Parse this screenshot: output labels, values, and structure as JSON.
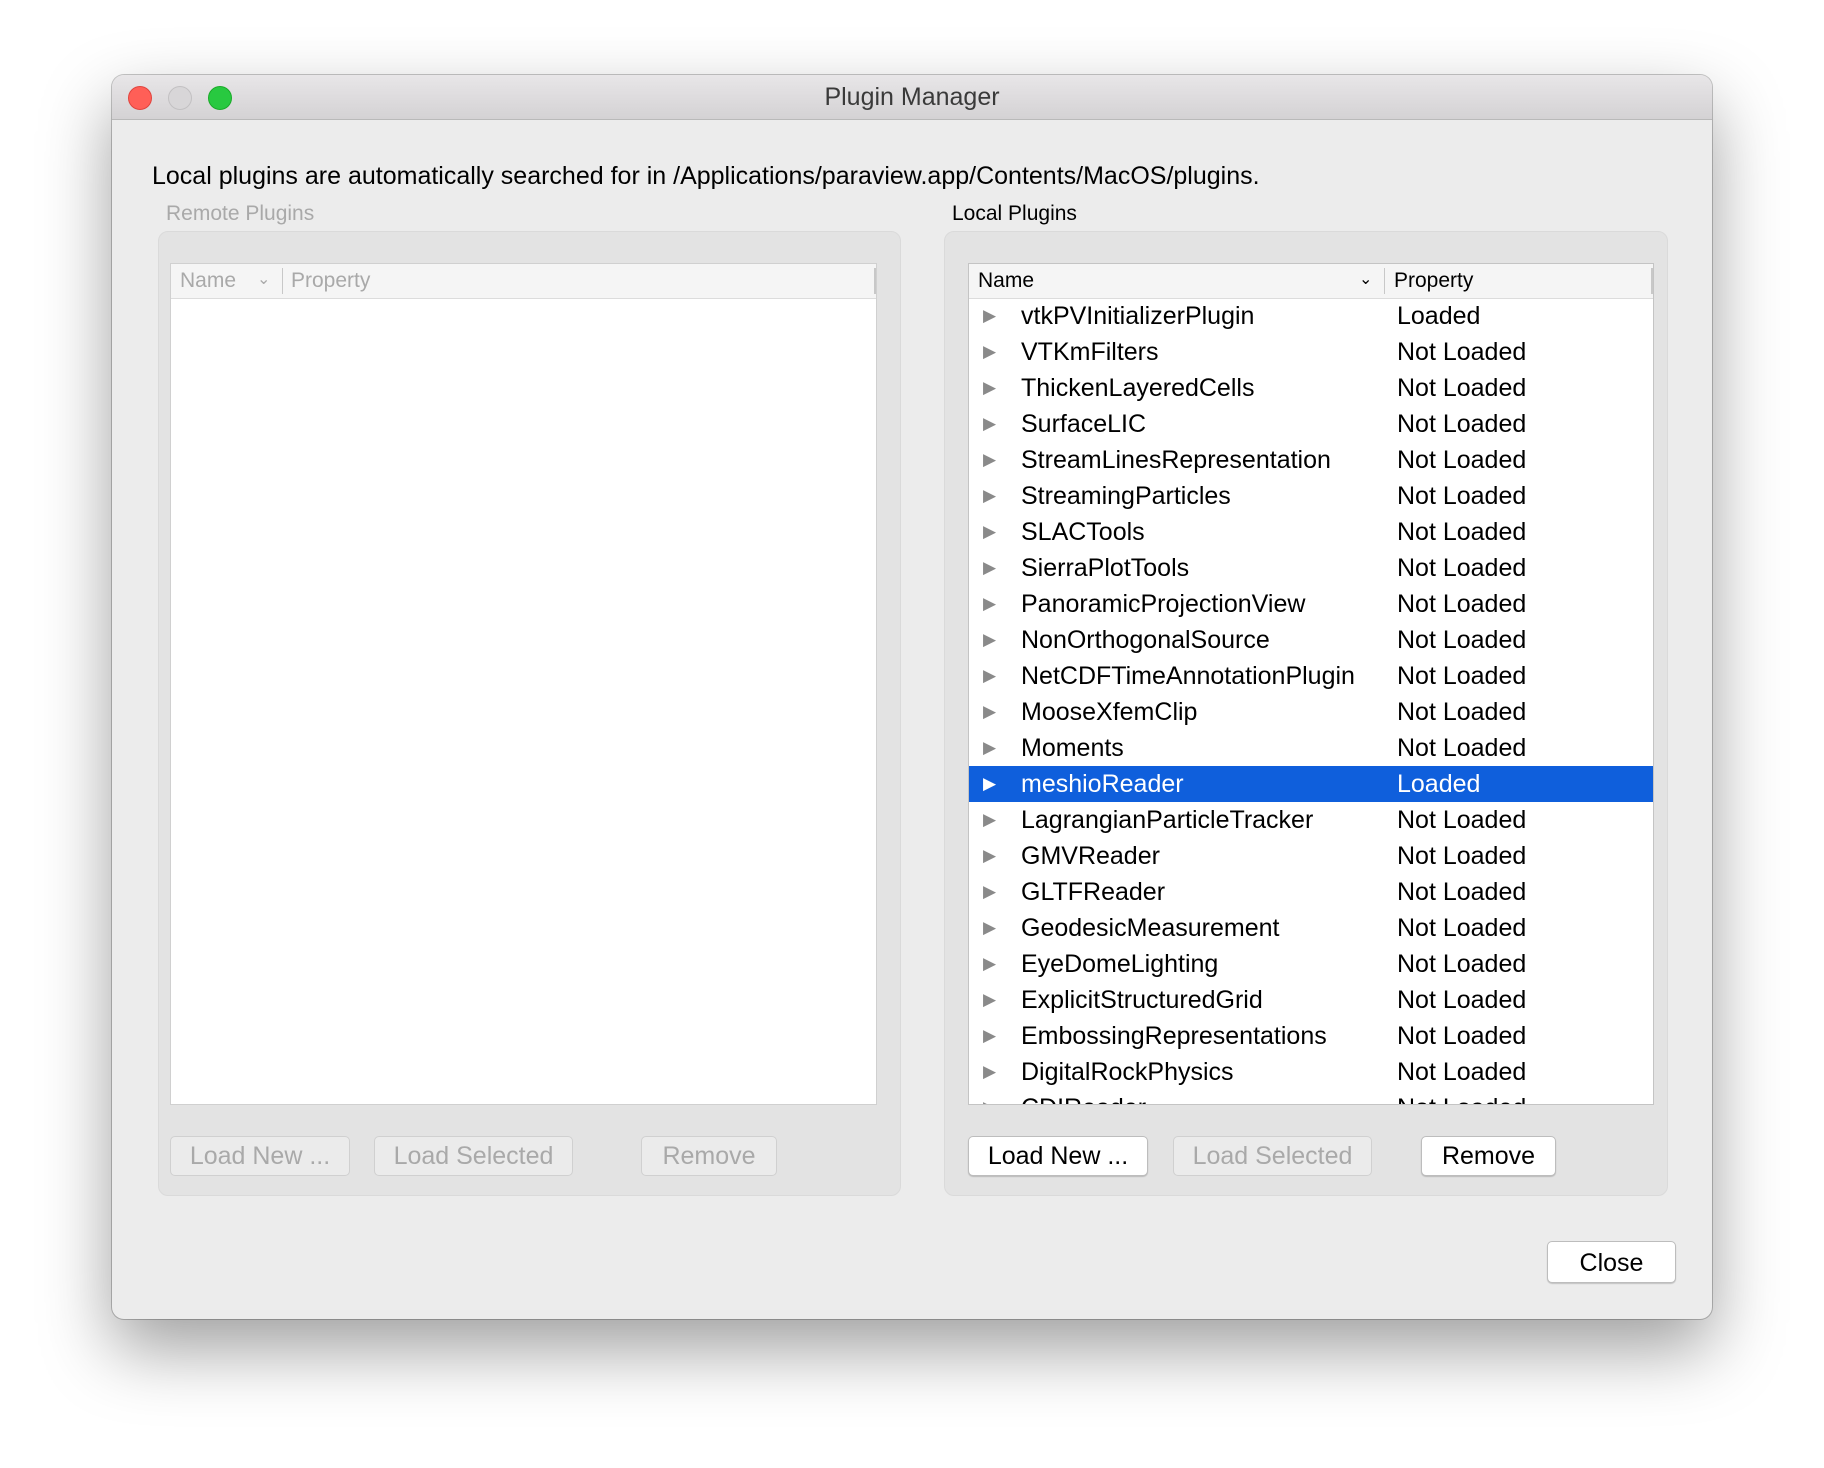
{
  "window": {
    "title": "Plugin Manager"
  },
  "info_text": "Local plugins are automatically searched for in /Applications/paraview.app/Contents/MacOS/plugins.",
  "remote": {
    "label": "Remote Plugins",
    "columns": {
      "name": "Name",
      "property": "Property"
    },
    "buttons": {
      "load_new": "Load New ...",
      "load_selected": "Load Selected",
      "remove": "Remove"
    }
  },
  "local": {
    "label": "Local Plugins",
    "columns": {
      "name": "Name",
      "property": "Property"
    },
    "plugins": [
      {
        "name": "vtkPVInitializerPlugin",
        "status": "Loaded"
      },
      {
        "name": "VTKmFilters",
        "status": "Not Loaded"
      },
      {
        "name": "ThickenLayeredCells",
        "status": "Not Loaded"
      },
      {
        "name": "SurfaceLIC",
        "status": "Not Loaded"
      },
      {
        "name": "StreamLinesRepresentation",
        "status": "Not Loaded"
      },
      {
        "name": "StreamingParticles",
        "status": "Not Loaded"
      },
      {
        "name": "SLACTools",
        "status": "Not Loaded"
      },
      {
        "name": "SierraPlotTools",
        "status": "Not Loaded"
      },
      {
        "name": "PanoramicProjectionView",
        "status": "Not Loaded"
      },
      {
        "name": "NonOrthogonalSource",
        "status": "Not Loaded"
      },
      {
        "name": "NetCDFTimeAnnotationPlugin",
        "status": "Not Loaded"
      },
      {
        "name": "MooseXfemClip",
        "status": "Not Loaded"
      },
      {
        "name": "Moments",
        "status": "Not Loaded"
      },
      {
        "name": "meshioReader",
        "status": "Loaded",
        "selected": true
      },
      {
        "name": "LagrangianParticleTracker",
        "status": "Not Loaded"
      },
      {
        "name": "GMVReader",
        "status": "Not Loaded"
      },
      {
        "name": "GLTFReader",
        "status": "Not Loaded"
      },
      {
        "name": "GeodesicMeasurement",
        "status": "Not Loaded"
      },
      {
        "name": "EyeDomeLighting",
        "status": "Not Loaded"
      },
      {
        "name": "ExplicitStructuredGrid",
        "status": "Not Loaded"
      },
      {
        "name": "EmbossingRepresentations",
        "status": "Not Loaded"
      },
      {
        "name": "DigitalRockPhysics",
        "status": "Not Loaded"
      },
      {
        "name": "CDIReader",
        "status": "Not Loaded"
      }
    ],
    "buttons": {
      "load_new": "Load New ...",
      "load_selected": "Load Selected",
      "remove": "Remove"
    }
  },
  "close_button": "Close",
  "colors": {
    "selection": "#0f5fdc",
    "window_bg": "#ececec"
  },
  "icons": {
    "expand": "disclosure-triangle-right",
    "sort": "chevron-down"
  }
}
